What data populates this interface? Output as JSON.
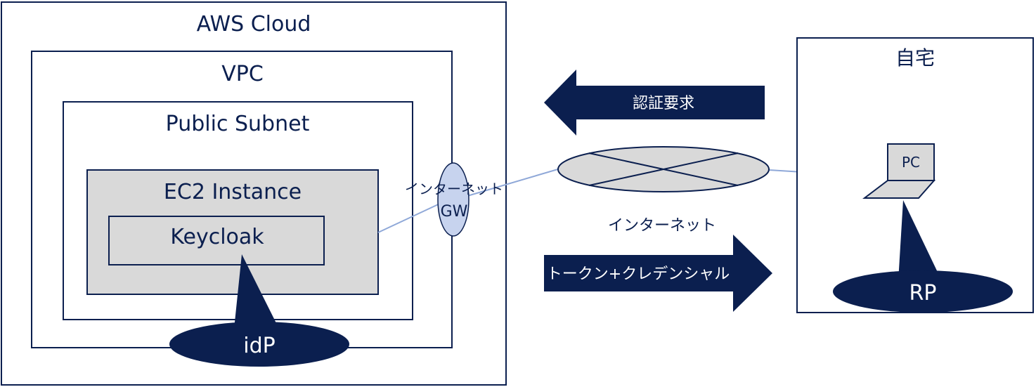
{
  "aws_cloud": {
    "label": "AWS Cloud"
  },
  "vpc": {
    "label": "VPC"
  },
  "public_subnet": {
    "label": "Public Subnet"
  },
  "ec2_instance": {
    "label": "EC2 Instance"
  },
  "keycloak": {
    "label": "Keycloak"
  },
  "idp_callout": {
    "label": "idP"
  },
  "internet_gateway": {
    "label_line1": "インターネット",
    "label_line2": "GW"
  },
  "internet": {
    "label": "インターネット"
  },
  "auth_request_arrow": {
    "label": "認証要求"
  },
  "token_arrow": {
    "label": "トークン+クレデンシャル"
  },
  "home": {
    "label": "自宅"
  },
  "pc": {
    "label": "PC"
  },
  "rp_callout": {
    "label": "RP"
  },
  "colors": {
    "navy": "#0b1f4f",
    "box_border": "#0b1f4f",
    "gray_fill": "#d9d9d9",
    "gw_fill": "#c7d3ee",
    "link_line": "#8fa8d8"
  }
}
